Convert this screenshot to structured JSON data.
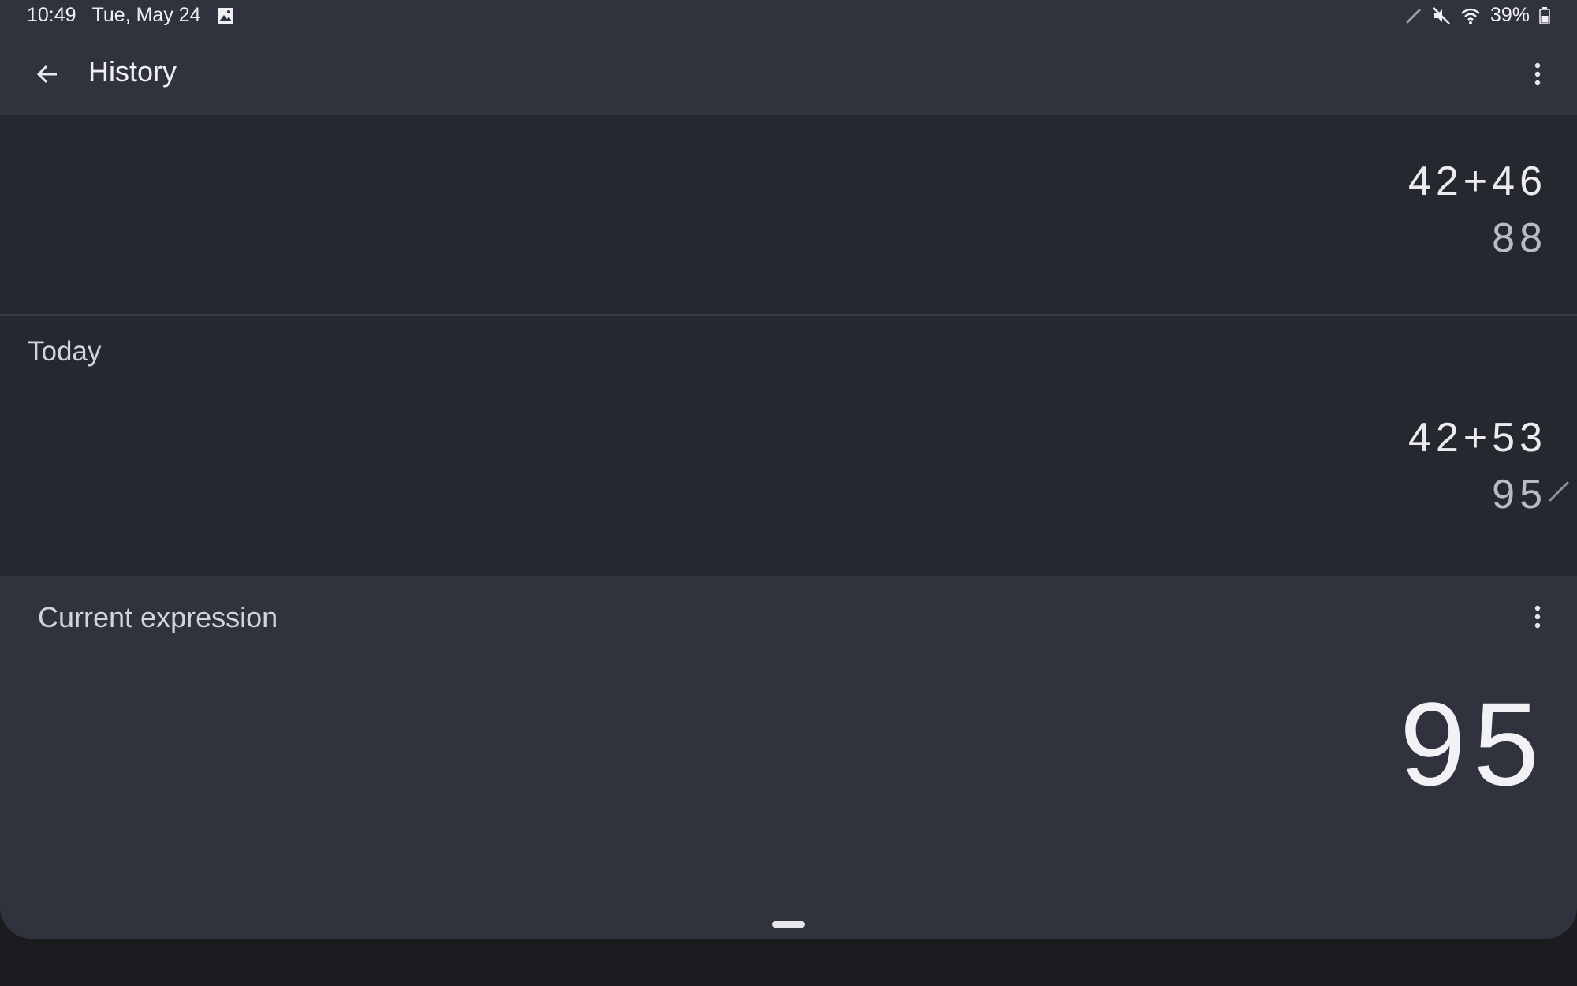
{
  "status_bar": {
    "time": "10:49",
    "date": "Tue, May 24",
    "battery": "39%",
    "icons": [
      "image-icon",
      "pen-icon",
      "mute-icon",
      "wifi-icon",
      "battery-icon"
    ]
  },
  "app_bar": {
    "title": "History",
    "back_icon": "arrow-back-icon",
    "menu_icon": "more-vert-icon"
  },
  "history": {
    "entries": [
      {
        "expression": "42+46",
        "result": "88"
      }
    ],
    "sections": [
      {
        "label": "Today",
        "entries": [
          {
            "expression": "42+53",
            "result": "95"
          }
        ]
      }
    ]
  },
  "current": {
    "label": "Current expression",
    "value": "95",
    "menu_icon": "more-vert-icon"
  },
  "colors": {
    "app_bar": "#30323e",
    "history_bg": "#262830",
    "panel_bg": "#30323e",
    "outer_bg": "#1b1c20"
  }
}
